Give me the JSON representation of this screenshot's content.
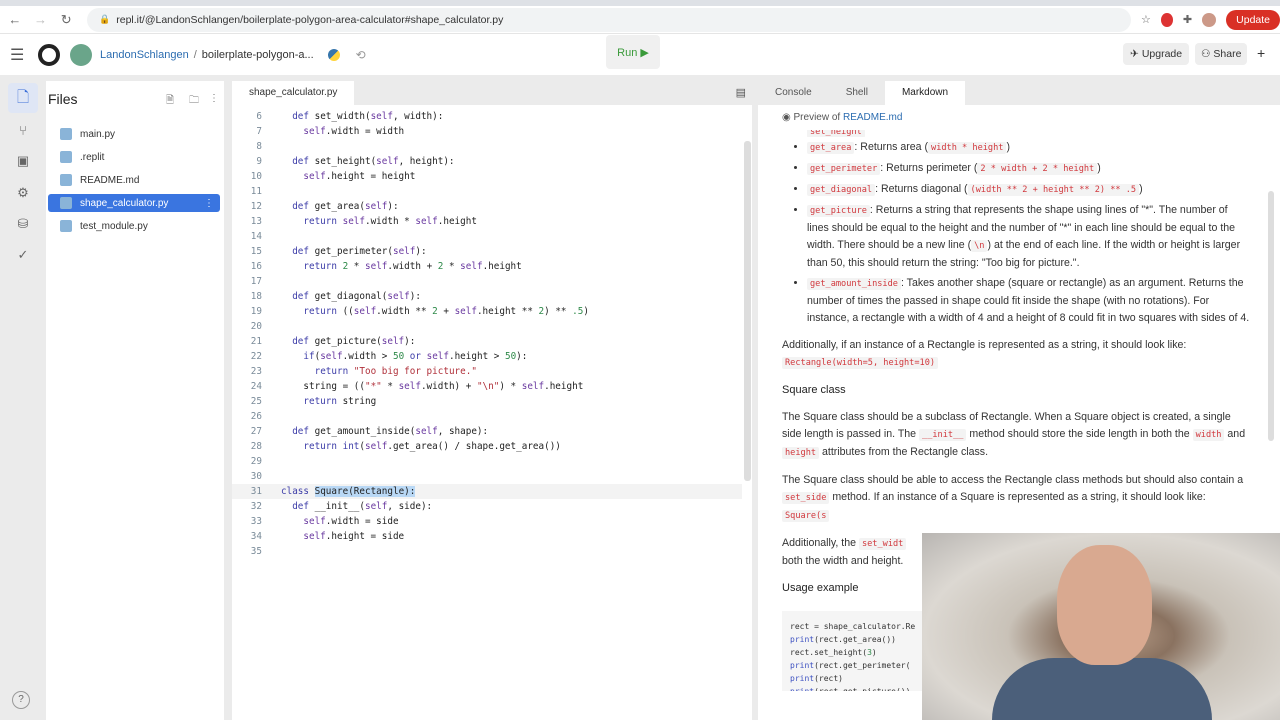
{
  "browser": {
    "url": "repl.it/@LandonSchlangen/boilerplate-polygon-area-calculator#shape_calculator.py",
    "update_label": "Update"
  },
  "header": {
    "user": "LandonSchlangen",
    "separator": "/",
    "repl": "boilerplate-polygon-a...",
    "run_label": "Run ▶",
    "upgrade_label": "Upgrade",
    "share_label": "Share",
    "plus": "+"
  },
  "files": {
    "title": "Files",
    "items": [
      "main.py",
      ".replit",
      "README.md",
      "shape_calculator.py",
      "test_module.py"
    ],
    "active": "shape_calculator.py"
  },
  "editor": {
    "tab": "shape_calculator.py",
    "first_line": 6,
    "current_line": 31,
    "lines": [
      "  def set_width(self, width):",
      "    self.width = width",
      "",
      "  def set_height(self, height):",
      "    self.height = height",
      "",
      "  def get_area(self):",
      "    return self.width * self.height",
      "",
      "  def get_perimeter(self):",
      "    return 2 * self.width + 2 * self.height",
      "",
      "  def get_diagonal(self):",
      "    return ((self.width ** 2 + self.height ** 2) ** .5)",
      "",
      "  def get_picture(self):",
      "    if(self.width > 50 or self.height > 50):",
      "      return \"Too big for picture.\"",
      "    string = ((\"*\" * self.width) + \"\\n\") * self.height",
      "    return string",
      "",
      "  def get_amount_inside(self, shape):",
      "    return int(self.get_area() / shape.get_area())",
      "",
      "",
      "class Square(Rectangle):",
      "  def __init__(self, side):",
      "    self.width = side",
      "    self.height = side",
      ""
    ],
    "selection": "Square(Rectangle):"
  },
  "right": {
    "tabs": [
      "Console",
      "Shell",
      "Markdown"
    ],
    "active": "Markdown",
    "preview_prefix": "Preview of ",
    "preview_file": "README.md",
    "md": {
      "cut": "set_height",
      "b1c": "get_area",
      "b1t": ": Returns area (",
      "b1x": "width * height",
      "b1e": ")",
      "b2c": "get_perimeter",
      "b2t": ": Returns perimeter (",
      "b2x": "2 * width + 2 * height",
      "b2e": ")",
      "b3c": "get_diagonal",
      "b3t": ": Returns diagonal (",
      "b3x": "(width ** 2 + height ** 2) ** .5",
      "b3e": ")",
      "b4c": "get_picture",
      "b4t": ": Returns a string that represents the shape using lines of \"*\". The number of lines should be equal to the height and the number of \"*\" in each line should be equal to the width. There should be a new line (",
      "b4x": "\\n",
      "b4e": ") at the end of each line. If the width or height is larger than 50, this should return the string: \"Too big for picture.\".",
      "b5c": "get_amount_inside",
      "b5t": ": Takes another shape (square or rectangle) as an argument. Returns the number of times the passed in shape could fit inside the shape (with no rotations). For instance, a rectangle with a width of 4 and a height of 8 could fit in two squares with sides of 4.",
      "p1": "Additionally, if an instance of a Rectangle is represented as a string, it should look like:",
      "p1c": "Rectangle(width=5, height=10)",
      "h_square": "Square class",
      "p2a": "The Square class should be a subclass of Rectangle. When a Square object is created, a single side length is passed in. The ",
      "p2c1": "__init__",
      "p2b": " method should store the side length in both the ",
      "p2c2": "width",
      "p2d": " and ",
      "p2c3": "height",
      "p2e": " attributes from the Rectangle class.",
      "p3a": "The Square class should be able to access the Rectangle class methods but should also contain a ",
      "p3c": "set_side",
      "p3b": " method. If an instance of a Square is represented as a string, it should look like: ",
      "p3c2": "Square(s",
      "p4a": "Additionally, the ",
      "p4c": "set_widt",
      "p4b": " both the width and height.",
      "h_usage": "Usage example",
      "usage": [
        "rect = shape_calculator.Re",
        "print(rect.get_area())",
        "rect.set_height(3)",
        "print(rect.get_perimeter(",
        "print(rect)",
        "print(rect.get_picture())"
      ]
    }
  }
}
